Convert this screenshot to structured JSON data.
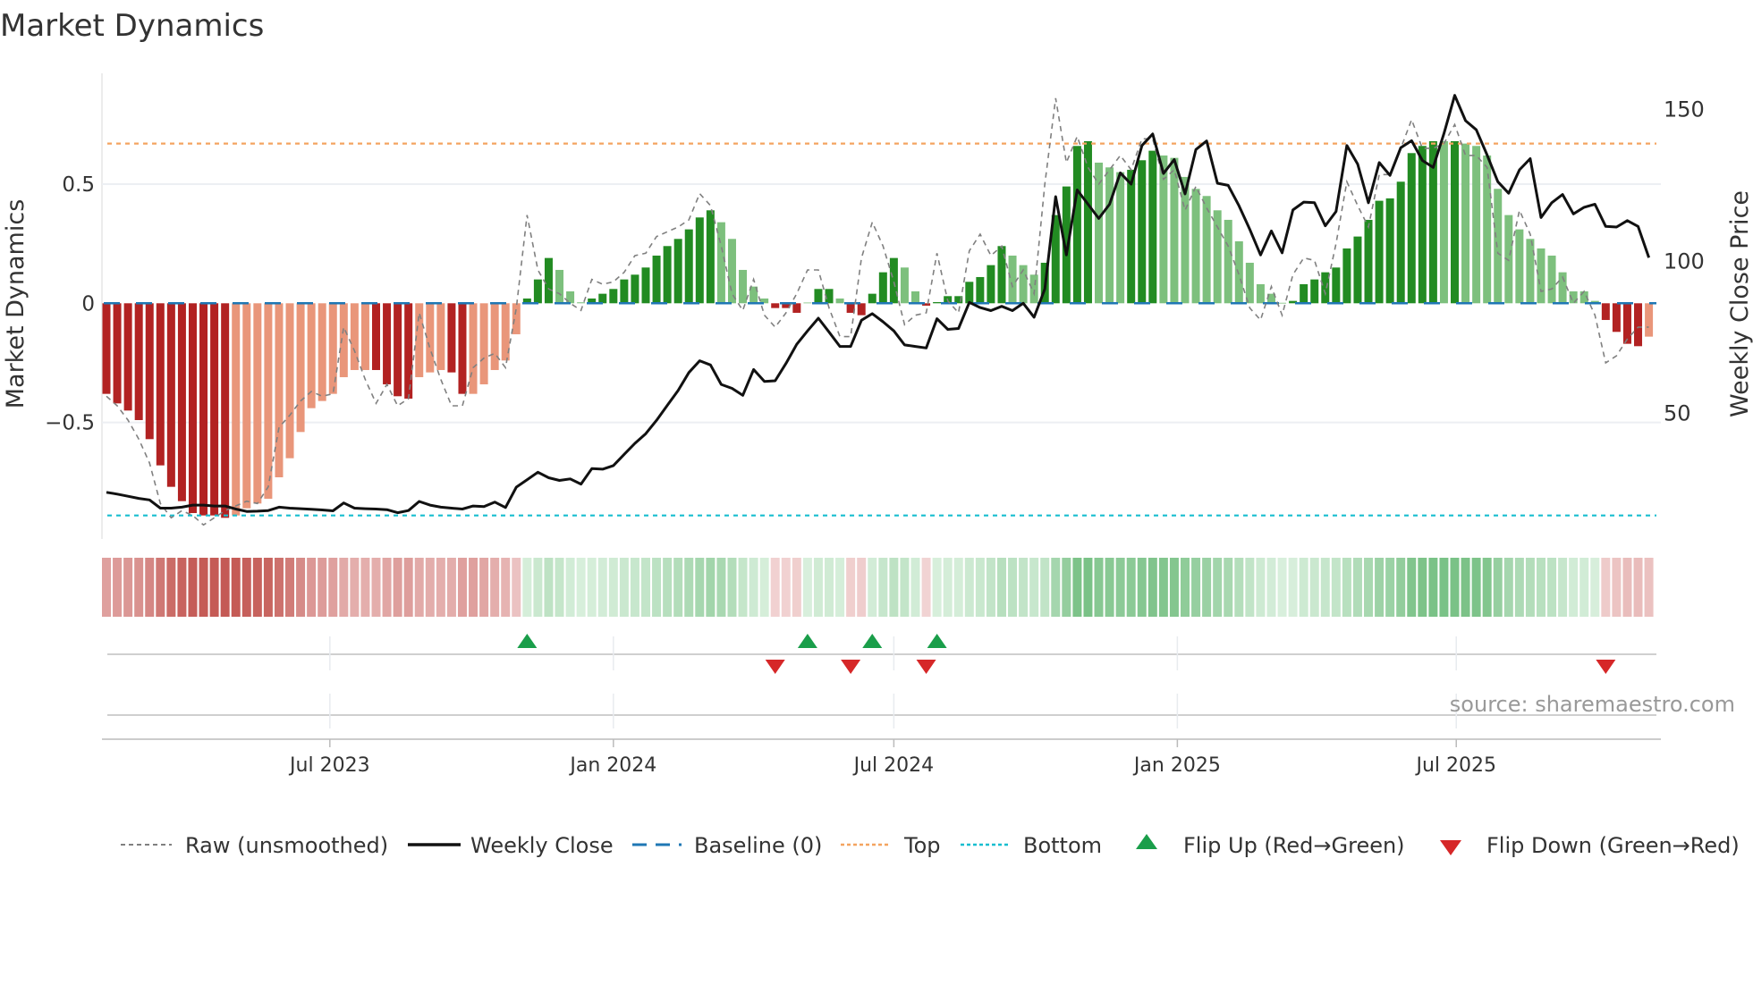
{
  "chart_data": {
    "type": "bar",
    "title": "Market Dynamics",
    "ylabel": "Market Dynamics",
    "ylabel_right": "Weekly Close Price",
    "frequency": "weekly",
    "start_date": "2023-02-06",
    "ylim": [
      -0.97,
      1.0
    ],
    "ylim_right": [
      20,
      160
    ],
    "yticks": [
      {
        "value": 0.5,
        "label": "0.5"
      },
      {
        "value": 0,
        "label": "0"
      },
      {
        "value": -0.5,
        "label": "−0.5"
      }
    ],
    "yticks_right": [
      {
        "value": 150,
        "label": "150"
      },
      {
        "value": 100,
        "label": "100"
      },
      {
        "value": 50,
        "label": "50"
      }
    ],
    "xticks": [
      {
        "date": "2023-07-01",
        "label": "Jul 2023"
      },
      {
        "date": "2024-01-01",
        "label": "Jan 2024"
      },
      {
        "date": "2024-07-01",
        "label": "Jul 2024"
      },
      {
        "date": "2025-01-01",
        "label": "Jan 2025"
      },
      {
        "date": "2025-07-01",
        "label": "Jul 2025"
      }
    ],
    "top_level": 0.67,
    "bottom_level": -0.89,
    "baseline": 0,
    "momentum": [
      -0.38,
      -0.42,
      -0.45,
      -0.49,
      -0.57,
      -0.68,
      -0.77,
      -0.83,
      -0.88,
      -0.89,
      -0.89,
      -0.9,
      -0.89,
      -0.86,
      -0.84,
      -0.82,
      -0.73,
      -0.65,
      -0.54,
      -0.44,
      -0.41,
      -0.38,
      -0.31,
      -0.28,
      -0.28,
      -0.28,
      -0.34,
      -0.39,
      -0.4,
      -0.31,
      -0.29,
      -0.28,
      -0.29,
      -0.38,
      -0.38,
      -0.34,
      -0.28,
      -0.24,
      -0.13,
      0.02,
      0.1,
      0.19,
      0.14,
      0.05,
      0.004,
      0.02,
      0.04,
      0.06,
      0.1,
      0.12,
      0.15,
      0.2,
      0.24,
      0.27,
      0.31,
      0.36,
      0.39,
      0.34,
      0.27,
      0.14,
      0.07,
      0.02,
      -0.02,
      -0.02,
      -0.04,
      0.003,
      0.06,
      0.06,
      0.02,
      -0.04,
      -0.05,
      0.04,
      0.13,
      0.19,
      0.15,
      0.05,
      -0.01,
      0.005,
      0.03,
      0.03,
      0.09,
      0.11,
      0.16,
      0.24,
      0.2,
      0.16,
      0.12,
      0.17,
      0.37,
      0.49,
      0.66,
      0.68,
      0.59,
      0.57,
      0.55,
      0.56,
      0.6,
      0.64,
      0.62,
      0.61,
      0.53,
      0.48,
      0.45,
      0.39,
      0.35,
      0.26,
      0.17,
      0.08,
      0.04,
      0.002,
      0.01,
      0.08,
      0.1,
      0.13,
      0.15,
      0.23,
      0.28,
      0.35,
      0.43,
      0.44,
      0.51,
      0.63,
      0.66,
      0.68,
      0.68,
      0.68,
      0.67,
      0.66,
      0.62,
      0.48,
      0.37,
      0.31,
      0.27,
      0.23,
      0.2,
      0.13,
      0.05,
      0.05,
      0.01,
      -0.07,
      -0.12,
      -0.17,
      -0.18,
      -0.14
    ],
    "shade_runs": [
      [
        12,
        "strong"
      ],
      [
        13,
        "weak"
      ],
      [
        4,
        "strong"
      ],
      [
        3,
        "weak"
      ],
      [
        2,
        "strong"
      ],
      [
        5,
        "weak"
      ],
      [
        3,
        "strong"
      ],
      [
        3,
        "weak"
      ],
      [
        12,
        "strong"
      ],
      [
        5,
        "weak"
      ],
      [
        3,
        "strong"
      ],
      [
        1,
        "weak"
      ],
      [
        2,
        "strong"
      ],
      [
        1,
        "weak"
      ],
      [
        5,
        "strong"
      ],
      [
        2,
        "weak"
      ],
      [
        8,
        "strong"
      ],
      [
        3,
        "weak"
      ],
      [
        5,
        "strong"
      ],
      [
        3,
        "weak"
      ],
      [
        3,
        "strong"
      ],
      [
        12,
        "weak"
      ],
      [
        14,
        "strong"
      ],
      [
        1,
        "weak"
      ],
      [
        1,
        "strong"
      ],
      [
        13,
        "weak"
      ],
      [
        4,
        "strong"
      ],
      [
        1,
        "weak"
      ]
    ],
    "raw": [
      -0.39,
      -0.43,
      -0.49,
      -0.57,
      -0.67,
      -0.84,
      -0.9,
      -0.87,
      -0.89,
      -0.93,
      -0.9,
      -0.87,
      -0.85,
      -0.83,
      -0.84,
      -0.77,
      -0.52,
      -0.47,
      -0.41,
      -0.37,
      -0.39,
      -0.38,
      -0.1,
      -0.2,
      -0.32,
      -0.42,
      -0.34,
      -0.43,
      -0.4,
      -0.04,
      -0.19,
      -0.32,
      -0.43,
      -0.43,
      -0.27,
      -0.23,
      -0.21,
      -0.27,
      -0.02,
      0.37,
      0.14,
      0.06,
      0.04,
      0.0,
      -0.03,
      0.1,
      0.08,
      0.09,
      0.13,
      0.2,
      0.21,
      0.28,
      0.3,
      0.32,
      0.35,
      0.46,
      0.41,
      0.24,
      0.04,
      -0.03,
      0.1,
      -0.05,
      -0.1,
      -0.04,
      0.04,
      0.14,
      0.14,
      -0.02,
      -0.14,
      -0.14,
      0.19,
      0.34,
      0.24,
      0.09,
      -0.09,
      -0.05,
      -0.04,
      0.21,
      0.01,
      -0.04,
      0.22,
      0.29,
      0.2,
      0.24,
      0.07,
      0.14,
      0.04,
      0.5,
      0.86,
      0.59,
      0.7,
      0.57,
      0.5,
      0.56,
      0.62,
      0.56,
      0.69,
      0.69,
      0.52,
      0.56,
      0.39,
      0.49,
      0.4,
      0.32,
      0.24,
      0.12,
      -0.02,
      -0.07,
      0.07,
      -0.05,
      0.12,
      0.19,
      0.18,
      0.04,
      0.25,
      0.51,
      0.41,
      0.32,
      0.54,
      0.54,
      0.65,
      0.77,
      0.65,
      0.65,
      0.67,
      0.75,
      0.62,
      0.62,
      0.57,
      0.21,
      0.18,
      0.39,
      0.29,
      0.05,
      0.06,
      0.11,
      0.0,
      0.05,
      -0.05,
      -0.25,
      -0.22,
      -0.15,
      -0.1,
      -0.1
    ],
    "close": [
      23.8,
      23.2,
      22.5,
      21.8,
      21.3,
      18.6,
      18.6,
      18.9,
      19.6,
      19.6,
      19.3,
      19.3,
      18.3,
      17.5,
      17.6,
      17.8,
      18.9,
      18.6,
      18.4,
      18.2,
      18.0,
      17.7,
      20.3,
      18.6,
      18.4,
      18.3,
      18.1,
      17.1,
      17.8,
      20.8,
      19.6,
      18.9,
      18.6,
      18.3,
      19.3,
      19.1,
      20.6,
      18.8,
      25.5,
      27.9,
      30.4,
      28.6,
      27.7,
      28.2,
      26.5,
      31.6,
      31.4,
      32.6,
      36.3,
      39.9,
      43.1,
      47.5,
      52.4,
      57.3,
      63.2,
      67.1,
      65.7,
      59.3,
      58.0,
      55.7,
      64.2,
      60.3,
      60.5,
      66.2,
      72.5,
      76.9,
      81.1,
      76.5,
      71.8,
      71.8,
      80.4,
      82.6,
      79.9,
      76.9,
      72.3,
      71.8,
      71.3,
      80.9,
      77.4,
      77.7,
      86.3,
      84.6,
      83.6,
      85.0,
      83.6,
      86.0,
      81.4,
      90.7,
      121.1,
      101.9,
      123.3,
      118.6,
      113.9,
      118.6,
      128.9,
      125.2,
      137.9,
      141.7,
      128.7,
      133.3,
      122.0,
      136.6,
      139.4,
      125.5,
      124.8,
      118.1,
      110.3,
      101.9,
      109.8,
      102.6,
      116.7,
      119.3,
      119.1,
      111.5,
      116.2,
      137.9,
      131.8,
      119.1,
      132.3,
      128.1,
      137.2,
      139.5,
      133.0,
      130.7,
      141.8,
      154.4,
      146.1,
      143.1,
      134.8,
      126.0,
      122.2,
      129.9,
      133.6,
      114.2,
      119.1,
      121.8,
      115.4,
      117.6,
      118.6,
      111.3,
      111.1,
      113.2,
      111.3,
      101.0
    ],
    "flip_up_weeks": [
      39,
      65,
      71,
      77
    ],
    "flip_down_weeks": [
      62,
      69,
      76,
      139
    ],
    "legend": [
      {
        "label": "Raw (unsmoothed)",
        "style": "dashed",
        "color": "#808080"
      },
      {
        "label": "Weekly Close",
        "style": "solid",
        "color": "#111111"
      },
      {
        "label": "Baseline (0)",
        "style": "dashed",
        "color": "#1f77b4"
      },
      {
        "label": "Top",
        "style": "dotted",
        "color": "#f4a460"
      },
      {
        "label": "Bottom",
        "style": "dotted",
        "color": "#17becf"
      },
      {
        "label": "Flip Up (Red→Green)",
        "style": "marker-up",
        "color": "#1a9e4a"
      },
      {
        "label": "Flip Down (Green→Red)",
        "style": "marker-down",
        "color": "#d62728"
      }
    ],
    "legend_position": "bottom",
    "source": "source: sharemaestro.com",
    "colors": {
      "pos_strong": "#228b22",
      "pos_weak": "#7dc07d",
      "neg_strong": "#b22222",
      "neg_weak": "#e9967a",
      "strip_pos_hi": "#5cb36b",
      "strip_pos_lo": "#d8efdc",
      "strip_neg_hi": "#c45a55",
      "strip_neg_lo": "#f2d4d4",
      "close": "#111111",
      "raw": "#808080",
      "baseline": "#1f77b4",
      "top": "#f4a460",
      "bottom": "#17becf",
      "flip_up": "#1a9e4a",
      "flip_down": "#d62728",
      "grid": "#eceff3",
      "axis": "#cccccc",
      "text": "#333333",
      "source": "#999999"
    }
  }
}
